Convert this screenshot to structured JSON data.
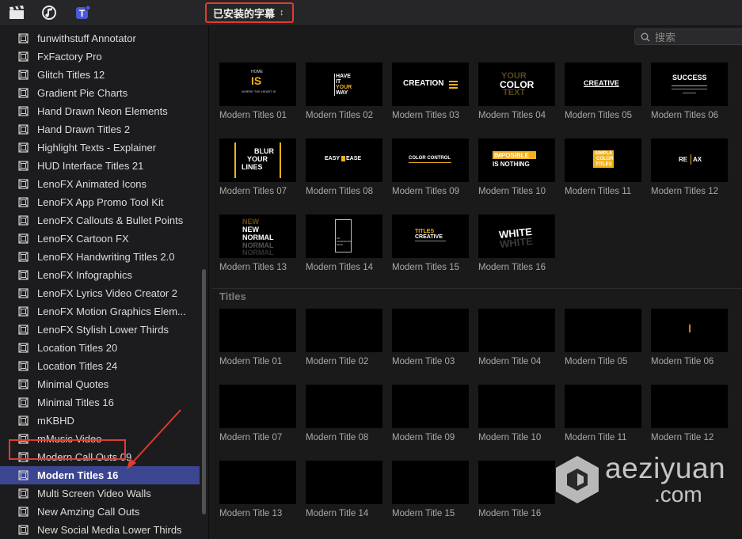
{
  "toolbar": {
    "icons": [
      "clapperboard-icon",
      "music-note-icon",
      "titles-icon"
    ],
    "dropdown_label": "已安装的字幕",
    "dropdown_chevron": "⌃⌄"
  },
  "search": {
    "placeholder": "搜索",
    "icon": "search-icon"
  },
  "sidebar": {
    "items": [
      "funwithstuff Annotator",
      "FxFactory Pro",
      "Glitch Titles 12",
      "Gradient Pie Charts",
      "Hand Drawn Neon Elements",
      "Hand Drawn Titles 2",
      "Highlight Texts - Explainer",
      "HUD Interface Titles 21",
      "LenoFX Animated Icons",
      "LenoFX App Promo Tool Kit",
      "LenoFX Callouts & Bullet Points",
      "LenoFX Cartoon FX",
      "LenoFX Handwriting Titles 2.0",
      "LenoFX Infographics",
      "LenoFX Lyrics Video Creator 2",
      "LenoFX Motion Graphics Elem...",
      "LenoFX Stylish Lower Thirds",
      "Location Titles 20",
      "Location Titles 24",
      "Minimal Quotes",
      "Minimal Titles 16",
      "mKBHD",
      "mMusic Video",
      "Modern Call Outs 09",
      "Modern Titles 16",
      "Multi Screen Video Walls",
      "New Amzing Call Outs",
      "New Social Media Lower Thirds"
    ],
    "selected": "Modern Titles 16"
  },
  "modern_titles": [
    {
      "label": "Modern Titles 01",
      "preview": [
        "HOME",
        "IS",
        "WHERE THE HEART IS"
      ]
    },
    {
      "label": "Modern Titles 02",
      "preview": [
        "HAVE",
        "IT",
        "YOUR",
        "WAY"
      ]
    },
    {
      "label": "Modern Titles 03",
      "preview": [
        "CREATION"
      ]
    },
    {
      "label": "Modern Titles 04",
      "preview": [
        "YOUR",
        "COLOR",
        "TEXT"
      ]
    },
    {
      "label": "Modern Titles 05",
      "preview": [
        "CREATIVE"
      ]
    },
    {
      "label": "Modern Titles 06",
      "preview": [
        "SUCCESS"
      ]
    },
    {
      "label": "Modern Titles 07",
      "preview": [
        "BLUR",
        "YOUR",
        "LINES"
      ]
    },
    {
      "label": "Modern Titles 08",
      "preview": [
        "EASY",
        "EASE"
      ]
    },
    {
      "label": "Modern Titles 09",
      "preview": [
        "COLOR CONTROL"
      ]
    },
    {
      "label": "Modern Titles 10",
      "preview": [
        "IMPOSIBLE",
        "IS NOTHING"
      ]
    },
    {
      "label": "Modern Titles 11",
      "preview": [
        "SIMPLE",
        "COLOR",
        "TITLES"
      ]
    },
    {
      "label": "Modern Titles 12",
      "preview": [
        "RE",
        "AX"
      ]
    },
    {
      "label": "Modern Titles 13",
      "preview": [
        "NEW",
        "NEW",
        "NORMAL",
        "NORMAL",
        "NORMAL"
      ]
    },
    {
      "label": "Modern Titles 14",
      "preview": [
        "NO",
        "CONDITIONS",
        "PACK"
      ]
    },
    {
      "label": "Modern Titles 15",
      "preview": [
        "TITLES",
        "CREATIVE"
      ]
    },
    {
      "label": "Modern Titles 16",
      "preview": [
        "WHITE",
        "WHITE"
      ]
    }
  ],
  "section_titles_heading": "Titles",
  "titles": [
    "Modern Title 01",
    "Modern Title 02",
    "Modern Title 03",
    "Modern Title 04",
    "Modern Title 05",
    "Modern Title 06",
    "Modern Title 07",
    "Modern Title 08",
    "Modern Title 09",
    "Modern Title 10",
    "Modern Title 11",
    "Modern Title 12",
    "Modern Title 13",
    "Modern Title 14",
    "Modern Title 15",
    "Modern Title 16"
  ],
  "watermark": {
    "line1": "aeziyuan",
    "line2": ".com"
  },
  "colors": {
    "accent_red": "#e23b2e",
    "selection": "#3c4690",
    "gold": "#f2b01e"
  }
}
